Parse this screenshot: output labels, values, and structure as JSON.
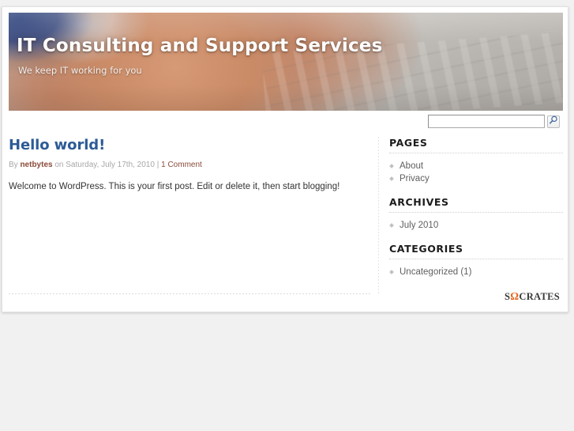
{
  "site": {
    "title": "IT Consulting and Support Services",
    "tagline": "We keep IT working for you",
    "header_image_alt": "hands-typing-on-keyboard-photo"
  },
  "search": {
    "value": "",
    "placeholder": "",
    "button_icon": "magnifier-icon",
    "button_label": ""
  },
  "post": {
    "title": "Hello world!",
    "meta": {
      "by_label": "By",
      "author": "netbytes",
      "on_label": "on",
      "date": "Saturday, July 17th, 2010",
      "separator": "|",
      "comments": "1 Comment"
    },
    "body": "Welcome to WordPress. This is your first post. Edit or delete it, then start blogging!"
  },
  "sidebar": {
    "widgets": [
      {
        "title": "PAGES",
        "items": [
          {
            "label": "About"
          },
          {
            "label": "Privacy"
          }
        ]
      },
      {
        "title": "ARCHIVES",
        "items": [
          {
            "label": "July 2010"
          }
        ]
      },
      {
        "title": "CATEGORIES",
        "items": [
          {
            "label": "Uncategorized (1)"
          }
        ]
      }
    ]
  },
  "footer": {
    "logo_prefix": "S",
    "logo_omega": "Ω",
    "logo_suffix": "CRATES"
  },
  "colors": {
    "page_background": "#f1f1f1",
    "page_surface": "#ffffff",
    "link_blue": "#2d5b96",
    "meta_link": "#8b4a3a",
    "accent_orange": "#e8641c",
    "heading_dark": "#1c1c1c"
  }
}
